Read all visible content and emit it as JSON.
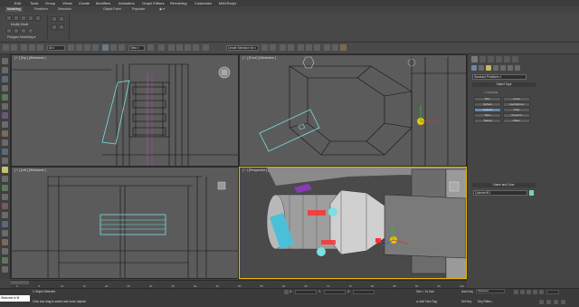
{
  "menubar": {
    "items": [
      "Edit",
      "Tools",
      "Group",
      "Views",
      "Create",
      "Modifiers",
      "Animation",
      "Graph Editors",
      "Rendering",
      "Customize",
      "MAXScript"
    ]
  },
  "ribbon": {
    "tabs": [
      "Modeling",
      "Freeform",
      "Selection",
      "Object Paint",
      "Populate"
    ],
    "group_label": "Modify Mode",
    "panel_label": "Polygon Modeling"
  },
  "toolbar": {
    "filter_dropdown": "All",
    "view_dropdown": "View",
    "named_selection": "Create Selection Se"
  },
  "viewports": {
    "top_left": {
      "label": "[ + ] [Top ] [Wireframe ]"
    },
    "top_right": {
      "label": "[ + ] [Front ] [Wireframe ]"
    },
    "bottom_left": {
      "label": "[ + ] [Left ] [Wireframe ]"
    },
    "bottom_right": {
      "label": "[ + ] [Perspective ] [ Shaded + Edged Faces ]"
    }
  },
  "command_panel": {
    "category_dropdown": "Standard Primitives",
    "object_type_header": "Object Type",
    "autogrid_label": "AutoGrid",
    "primitives": [
      "Box",
      "Cone",
      "Sphere",
      "GeoSphere",
      "Cylinder",
      "Tube",
      "Torus",
      "Pyramid",
      "Teapot",
      "Plane"
    ],
    "name_color_header": "Name and Color",
    "object_name": "Cylinder001",
    "swatch_color": "#7ad0b0"
  },
  "timeline": {
    "ticks": [
      "0",
      "5",
      "10",
      "15",
      "20",
      "25",
      "30",
      "35",
      "40",
      "45",
      "50",
      "55",
      "60",
      "65",
      "70",
      "75",
      "80",
      "85",
      "90",
      "95",
      "100"
    ]
  },
  "statusbar": {
    "maxscript_label": "Welcome to M",
    "selection_info": "1 Object Selected",
    "prompt": "Click and drag to select and move objects",
    "grid_label": "Grid = 10.0cm",
    "add_time_tag": "Add Time Tag",
    "auto_key_label": "Auto Key",
    "auto_key_value": "Selected",
    "set_key_label": "Set Key",
    "key_filters_label": "Key Filters..."
  }
}
